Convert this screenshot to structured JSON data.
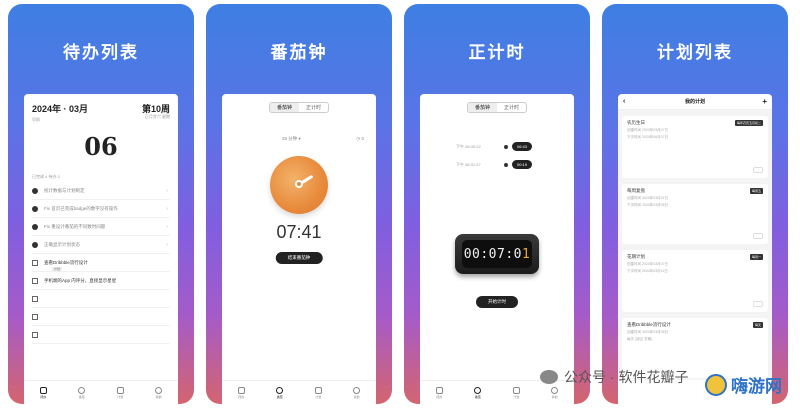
{
  "cards": [
    {
      "title": "待办列表",
      "month": "2024年 · 03月",
      "week": "第10周",
      "sub_left": "早前",
      "sub_right": "正月廿六  星期",
      "day": "06",
      "caption": "已完成 4   待办 3",
      "todos": [
        {
          "text": "统计数据与计划制定",
          "done": true
        },
        {
          "text": "Fix 首页已完成badge的数字没有操作",
          "done": true
        },
        {
          "text": "Fix 重设计番茄的不同数时间题",
          "done": true
        },
        {
          "text": "正确显示计划状态",
          "done": true
        },
        {
          "text": "查看Dribbble流行设计",
          "done": false,
          "tag": "计划"
        },
        {
          "text": "手机端的App 内评分，直接显示星星",
          "done": false
        },
        {
          "text": "",
          "done": false
        },
        {
          "text": "",
          "done": false
        },
        {
          "text": "",
          "done": false
        }
      ],
      "tabs": [
        "待办",
        "番茄",
        "计划",
        "我的"
      ]
    },
    {
      "title": "番茄钟",
      "seg": [
        "番茄钟",
        "正计时"
      ],
      "duration": "25 分钟",
      "count": "0",
      "time": "07:41",
      "button": "结束番茄钟",
      "tabs": [
        "待办",
        "番茄",
        "计划",
        "我的"
      ]
    },
    {
      "title": "正计时",
      "seg": [
        "番茄钟",
        "正计时"
      ],
      "laps": [
        {
          "label": "下午 06:40:22",
          "value": "06:43"
        },
        {
          "label": "下午 06:31:27",
          "value": "00:19"
        }
      ],
      "clock_main": "00:07:0",
      "clock_accent": "1",
      "button": "开始计时",
      "tabs": [
        "待办",
        "番茄",
        "计划",
        "我的"
      ]
    },
    {
      "title": "计划列表",
      "nav_title": "我的计划",
      "back": "‹",
      "add": "+",
      "plans": [
        {
          "name": "农历生日",
          "tag": "每年农历五月初二",
          "meta1": "创建时间  2024年03月07日",
          "meta2": "下次时间  2024年06月07日"
        },
        {
          "name": "每周复盘",
          "tag": "每周五",
          "meta1": "创建时间  2024年03月01日",
          "meta2": "下次时间  2024年03月08日"
        },
        {
          "name": "花期计划",
          "tag": "每周一",
          "meta1": "创建时间  2024年03月07日",
          "meta2": "下次时间  2024年03月11日"
        },
        {
          "name": "查看Dribbble流行设计",
          "tag": "每天",
          "meta1": "创建时间  2024年03月06日",
          "meta2": "每天  (阅过 学期)"
        }
      ],
      "tabs": [
        "待办",
        "番茄",
        "计划",
        "我的"
      ]
    }
  ],
  "watermark": {
    "text": "公众号 · 软件花瓣子",
    "site": "嗨游网"
  }
}
